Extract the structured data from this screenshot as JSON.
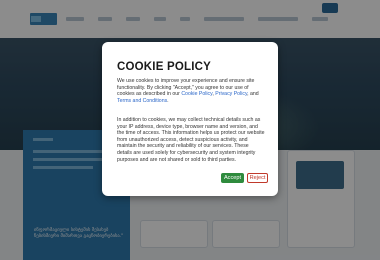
{
  "cookie_modal": {
    "title": "COOKIE POLICY",
    "paragraph1_before": "We use cookies to improve your experience and ensure site functionality. By clicking \"Accept,\" you agree to our use of cookies as described in our ",
    "link_cookie_policy": "Cookie Policy",
    "sep1": ", ",
    "link_privacy_policy": "Privacy Policy",
    "sep2": ", and ",
    "link_terms": "Terms and Conditions",
    "paragraph1_end": ".",
    "paragraph2": "In addition to cookies, we may collect technical details such as your IP address, device type, browser name and version, and the time of access. This information helps us protect our website from unauthorized access, detect suspicious activity, and maintain the security and reliability of our services. These details are used solely for cybersecurity and system integrity purposes and are not shared or sold to third parties.",
    "accept_label": "Accept",
    "reject_label": "Reject"
  },
  "background": {
    "card_quote": "ინფორმაციული სისტემის შესახებ ნებისმიერი მიმართვა გაცნობიერებისა.\""
  },
  "colors": {
    "accept": "#2e8b3d",
    "reject": "#c0392b",
    "link": "#2a66c8",
    "brand": "#3a86b8"
  }
}
